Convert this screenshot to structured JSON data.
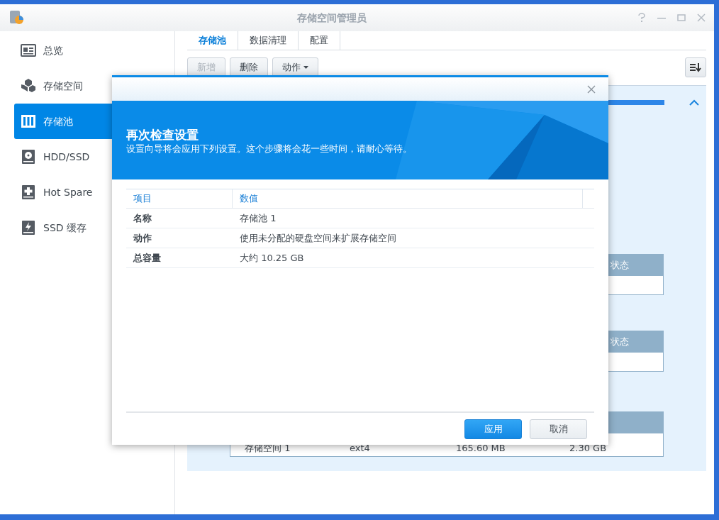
{
  "window": {
    "title": "存储空间管理员"
  },
  "sidebar": {
    "items": [
      {
        "label": "总览",
        "kind": "overview",
        "selected": false
      },
      {
        "label": "存储空间",
        "kind": "cubes",
        "selected": false
      },
      {
        "label": "存储池",
        "kind": "pool",
        "selected": true
      },
      {
        "label": "HDD/SSD",
        "kind": "disk",
        "selected": false
      },
      {
        "label": "Hot Spare",
        "kind": "plus",
        "selected": false
      },
      {
        "label": "SSD 缓存",
        "kind": "bolt",
        "selected": false
      }
    ]
  },
  "tabs": [
    {
      "label": "存储池",
      "selected": true
    },
    {
      "label": "数据清理",
      "selected": false
    },
    {
      "label": "配置",
      "selected": false
    }
  ],
  "toolbar": [
    {
      "label": "新增",
      "disabled": true,
      "menu": false
    },
    {
      "label": "删除",
      "disabled": false,
      "menu": false
    },
    {
      "label": "动作",
      "disabled": false,
      "menu": true
    }
  ],
  "pool_panel": {
    "tables": [
      {
        "header": "状态"
      },
      {
        "header": "状态"
      },
      {
        "rows": [
          [
            "存储空间 1",
            "ext4",
            "165.60 MB",
            "2.30 GB"
          ]
        ]
      }
    ]
  },
  "dialog": {
    "title": "再次检查设置",
    "subtitle": "设置向导将会应用下列设置。这个步骤将会花一些时间，请耐心等待。",
    "columns": [
      "项目",
      "数值"
    ],
    "rows": [
      [
        "名称",
        "存储池 1"
      ],
      [
        "动作",
        "使用未分配的硬盘空间来扩展存储空间"
      ],
      [
        "总容量",
        "大约 10.25 GB"
      ]
    ],
    "buttons": [
      {
        "label": "应用",
        "kind": "primary"
      },
      {
        "label": "取消",
        "kind": "secondary"
      }
    ]
  }
}
